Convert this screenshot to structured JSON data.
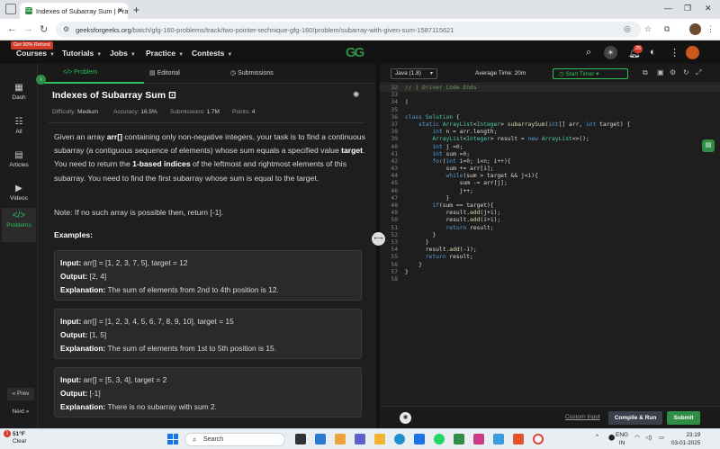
{
  "browser": {
    "tab_title": "Indexes of Subarray Sum | Prac",
    "url_domain": "geeksforgeeks.org",
    "url_path": "/batch/gfg-160-problems/track/two-pointer-technique-gfg-160/problem/subarray-with-given-sum-1587115621"
  },
  "gfg_nav": {
    "referral_badge": "Get 90% Refund",
    "items": [
      "Courses",
      "Tutorials",
      "Jobs",
      "Practice",
      "Contests"
    ],
    "notification_count": "25"
  },
  "sidebar": {
    "items": [
      {
        "label": "Dash",
        "icon": "dashboard-icon"
      },
      {
        "label": "All",
        "icon": "grid-icon"
      },
      {
        "label": "Articles",
        "icon": "article-icon"
      },
      {
        "label": "Videos",
        "icon": "video-icon"
      },
      {
        "label": "Problems",
        "icon": "code-icon"
      }
    ],
    "prev_label": "« Prev",
    "next_label": "Next »"
  },
  "problem": {
    "tabs": [
      "</> Problem",
      "Editorial",
      "Submissions"
    ],
    "title": "Indexes of Subarray Sum",
    "meta": {
      "difficulty_label": "Difficulty:",
      "difficulty": "Medium",
      "accuracy_label": "Accuracy:",
      "accuracy": "16.5%",
      "submissions_label": "Submissions:",
      "submissions": "1.7M",
      "points_label": "Points:",
      "points": "4"
    },
    "desc_1": "Given an array ",
    "desc_arr": "arr[]",
    "desc_2": " containing only non-negative integers, your task is to find a continuous subarray (a contiguous sequence of elements) whose sum equals a specified value ",
    "desc_target": "target",
    "desc_3": ". You need to return the ",
    "desc_1based": "1-based indices",
    "desc_4": " of the leftmost and rightmost elements of this subarray. You need to find the first subarray whose sum is equal to the target.",
    "note": "Note: If no such array is possible then, return [-1].",
    "examples_heading": "Examples:",
    "input_label": "Input:",
    "output_label": "Output:",
    "explanation_label": "Explanation:",
    "examples": [
      {
        "input": " arr[] = [1, 2, 3, 7, 5], target = 12",
        "output": " [2, 4]",
        "explanation": " The sum of elements from 2nd to 4th position is 12."
      },
      {
        "input": " arr[] = [1, 2, 3, 4, 5, 6, 7, 8, 9, 10], target = 15",
        "output": " [1, 5]",
        "explanation": " The sum of elements from 1st to 5th position is 15."
      },
      {
        "input": " arr[] = [5, 3, 4], target = 2",
        "output": " [-1]",
        "explanation": " There is no subarray with sum 2."
      }
    ]
  },
  "editor": {
    "language": "Java (1.8)",
    "avg_time": "Average Time: 20m",
    "start_timer": "Start Timer",
    "custom_input": "Custom Input",
    "compile_run": "Compile & Run",
    "submit": "Submit"
  },
  "taskbar": {
    "weather_temp": "51°F",
    "weather_desc": "Clear",
    "search_placeholder": "Search",
    "lang_line1": "ENG",
    "lang_line2": "IN",
    "time": "23:19",
    "date": "03-01-2025"
  }
}
